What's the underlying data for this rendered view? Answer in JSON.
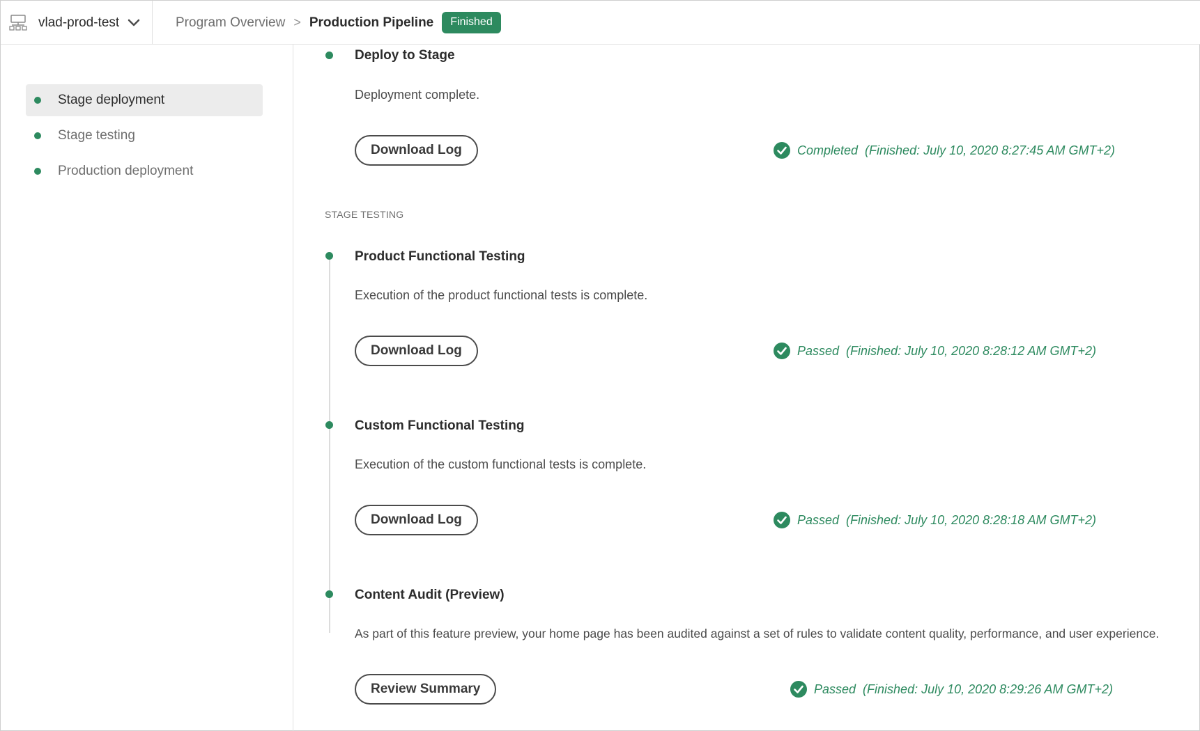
{
  "colors": {
    "accent": "#2d8a5f",
    "text": "#2c2c2c",
    "muted": "#6e6e6e",
    "divider": "#e1e1e1"
  },
  "header": {
    "program_name": "vlad-prod-test",
    "breadcrumb_parent": "Program Overview",
    "breadcrumb_separator": ">",
    "breadcrumb_current": "Production Pipeline",
    "status_badge": "Finished"
  },
  "sidebar": {
    "items": [
      {
        "label": "Stage deployment",
        "active": true
      },
      {
        "label": "Stage testing",
        "active": false
      },
      {
        "label": "Production deployment",
        "active": false
      }
    ]
  },
  "main": {
    "deploy": {
      "title": "Deploy to Stage",
      "description": "Deployment complete.",
      "button": "Download Log",
      "status": "Completed",
      "finished": "(Finished: July 10, 2020 8:27:45 AM GMT+2)"
    },
    "stage_testing_label": "STAGE TESTING",
    "steps": [
      {
        "title": "Product Functional Testing",
        "description": "Execution of the product functional tests is complete.",
        "button": "Download Log",
        "status": "Passed",
        "finished": "(Finished: July 10, 2020 8:28:12 AM GMT+2)"
      },
      {
        "title": "Custom Functional Testing",
        "description": "Execution of the custom functional tests is complete.",
        "button": "Download Log",
        "status": "Passed",
        "finished": "(Finished: July 10, 2020 8:28:18 AM GMT+2)"
      },
      {
        "title": "Content Audit (Preview)",
        "description": "As part of this feature preview, your home page has been audited against a set of rules to validate content quality, performance, and user experience.",
        "button": "Review Summary",
        "status": "Passed",
        "finished": "(Finished: July 10, 2020 8:29:26 AM GMT+2)"
      }
    ]
  }
}
